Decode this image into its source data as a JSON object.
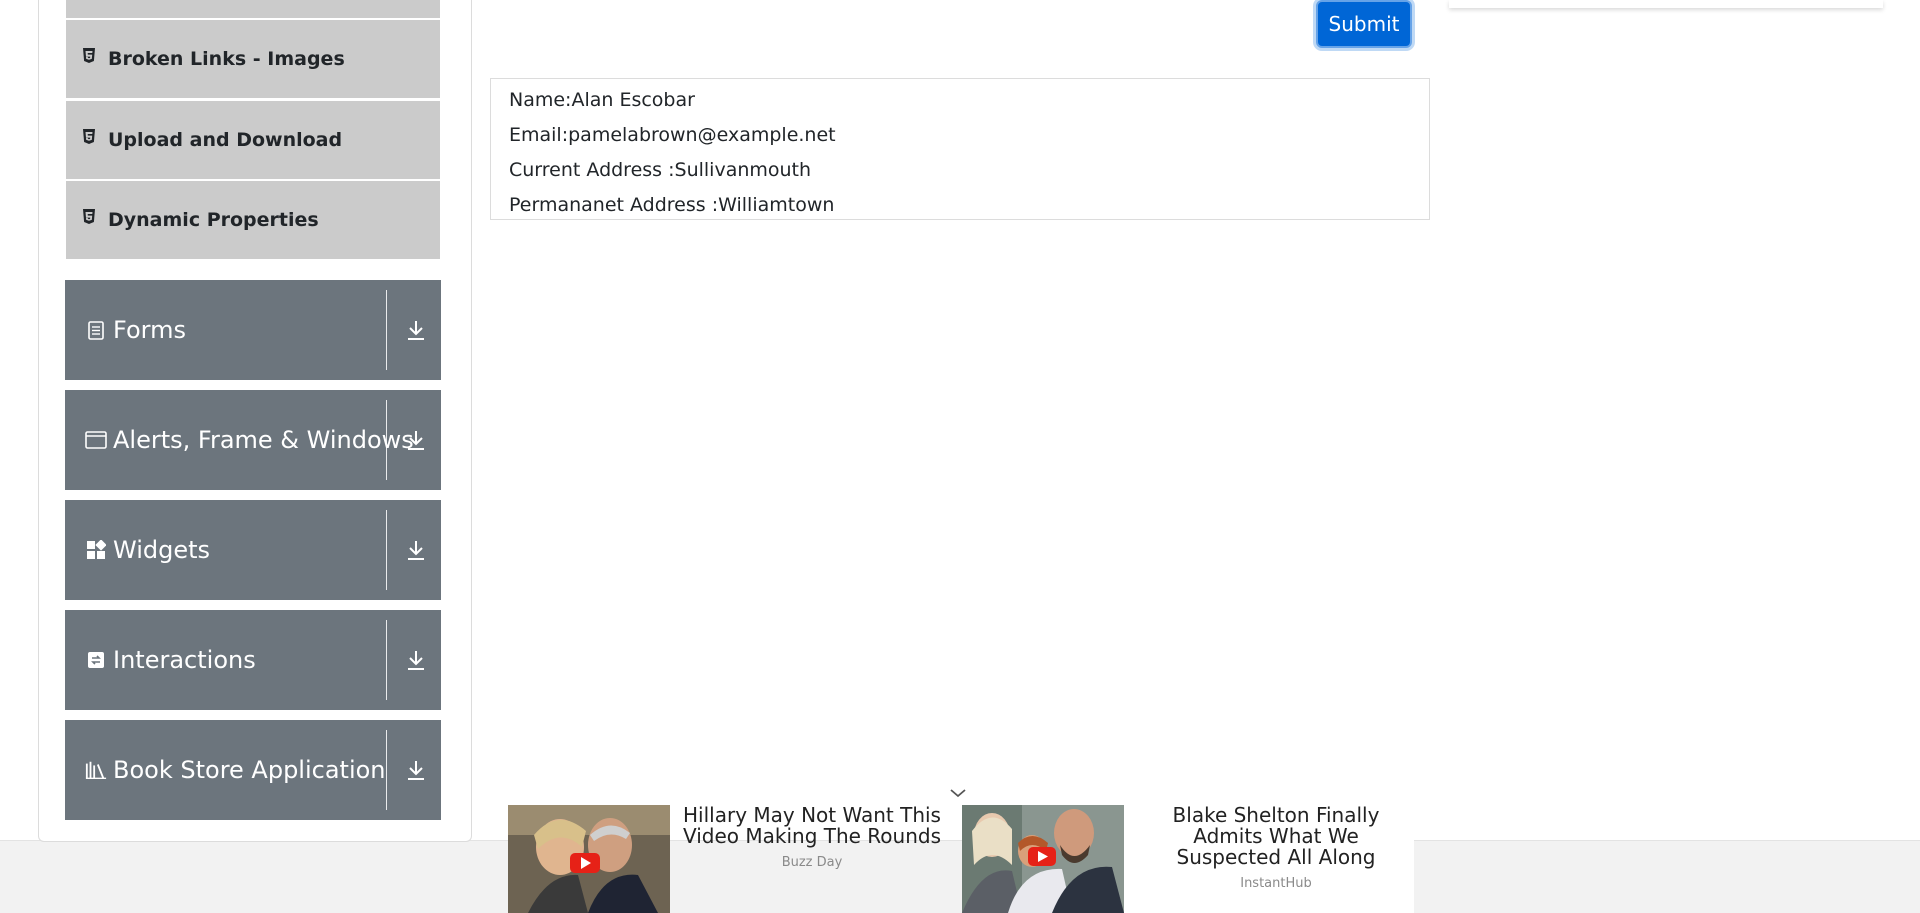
{
  "sidebar": {
    "elements_items": [
      {
        "label": "Broken Links - Images"
      },
      {
        "label": "Upload and Download"
      },
      {
        "label": "Dynamic Properties"
      }
    ],
    "groups": [
      {
        "label": "Forms",
        "icon": "document-icon"
      },
      {
        "label": "Alerts, Frame & Windows",
        "icon": "window-icon"
      },
      {
        "label": "Widgets",
        "icon": "widgets-grid-icon"
      },
      {
        "label": "Interactions",
        "icon": "interactions-icon"
      },
      {
        "label": "Book Store Application",
        "icon": "books-icon"
      }
    ]
  },
  "form": {
    "submit_label": "Submit"
  },
  "output": {
    "name": "Name:Alan Escobar",
    "email": "Email:pamelabrown@example.net",
    "current_address": "Current Address :Sullivanmouth",
    "permanent_address": "Permananet Address :Williamtown"
  },
  "ads": [
    {
      "headline": "Hillary May Not Want This Video Making The Rounds",
      "source": "Buzz Day",
      "icon": "play-icon"
    },
    {
      "headline": "Blake Shelton Finally Admits What We Suspected All Along",
      "source": "InstantHub",
      "icon": "play-icon"
    }
  ],
  "colors": {
    "group_bg": "#6c757d",
    "sub_item_bg": "#cbcbcb",
    "submit_bg": "#0066d6"
  }
}
